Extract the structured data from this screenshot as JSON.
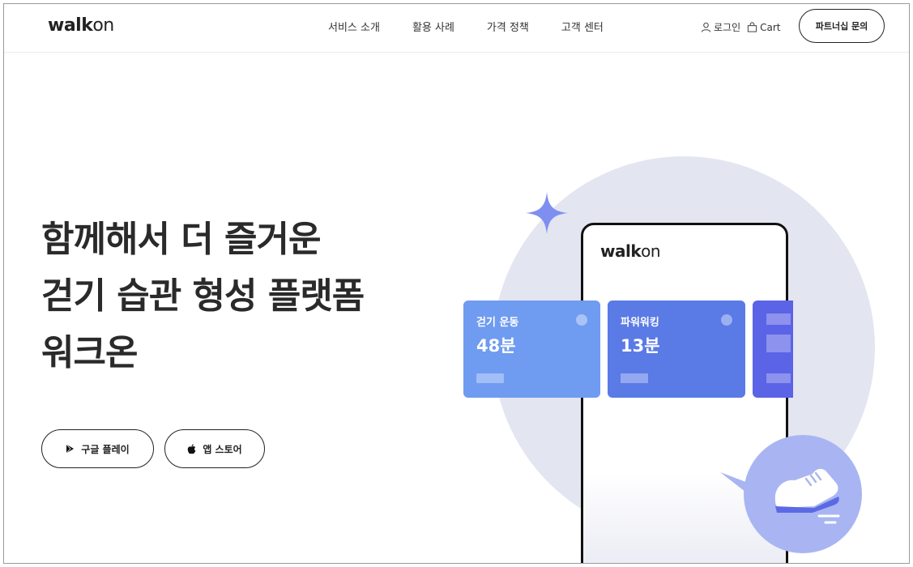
{
  "header": {
    "logo": "walk",
    "logo_suffix": "on",
    "nav": [
      "서비스 소개",
      "활용 사례",
      "가격 정책",
      "고객 센터"
    ],
    "login_label": "로그인",
    "cart_label": "Cart",
    "partner_button": "파트너십 문의"
  },
  "hero": {
    "headline_lines": [
      "함께해서 더 즐거운",
      "걷기 습관 형성 플랫폼",
      "워크온"
    ],
    "google_play_label": "구글 플레이",
    "app_store_label": "앱 스토어"
  },
  "illustration": {
    "phone_logo": "walk",
    "phone_logo_suffix": "on",
    "cards": [
      {
        "title": "걷기 운동",
        "value": "48분",
        "color": "#6f9bf1"
      },
      {
        "title": "파워워킹",
        "value": "13분",
        "color": "#5a7ae6"
      }
    ]
  },
  "icons": {
    "login": "user-icon",
    "cart": "shopping-bag-icon",
    "google_play": "play-store-icon",
    "app_store": "apple-icon",
    "sparkle": "sparkle-icon",
    "shoe": "sneaker-icon"
  }
}
